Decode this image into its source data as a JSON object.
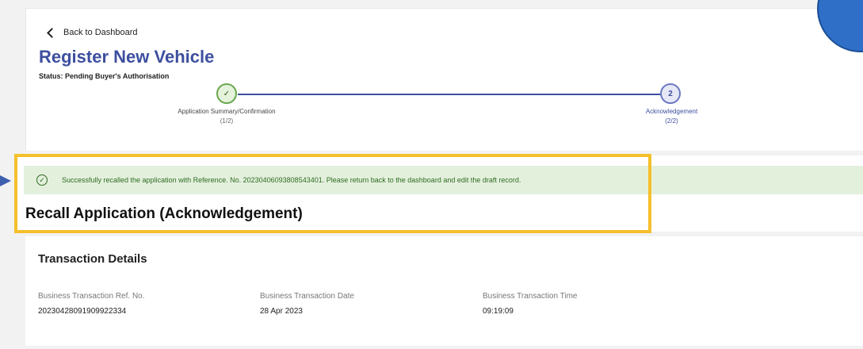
{
  "nav": {
    "back_label": "Back to Dashboard"
  },
  "page": {
    "title": "Register New Vehicle",
    "status": "Status: Pending Buyer's Authorisation"
  },
  "stepper": {
    "steps": [
      {
        "number": "✓",
        "label": "Application Summary/Confirmation",
        "sub": "(1/2)",
        "state": "completed"
      },
      {
        "number": "2",
        "label": "Acknowledgement",
        "sub": "(2/2)",
        "state": "current"
      }
    ]
  },
  "alert": {
    "icon": "check-circle-icon",
    "message": "Successfully recalled the application with Reference. No. 20230406093808543401. Please return back to the dashboard and edit the draft record."
  },
  "section": {
    "title": "Recall Application (Acknowledgement)"
  },
  "transaction": {
    "title": "Transaction Details",
    "fields": [
      {
        "label": "Business Transaction Ref. No.",
        "value": "20230428091909922334"
      },
      {
        "label": "Business Transaction Date",
        "value": "28 Apr 2023"
      },
      {
        "label": "Business Transaction Time",
        "value": "09:19:09"
      }
    ]
  },
  "colors": {
    "title_blue": "#3d4f9f",
    "success_bg": "#e3f0dc",
    "success_text": "#2f6b22",
    "highlight": "#f5c02c",
    "annotation_blue": "#2f6fc8"
  }
}
